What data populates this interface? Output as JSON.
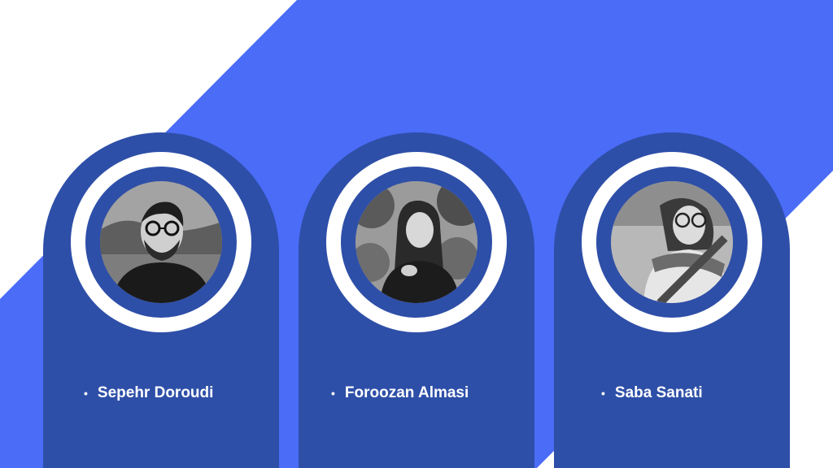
{
  "colors": {
    "accent": "#4a6cf7",
    "card": "#2e4fa8",
    "ring": "#ffffff"
  },
  "team": [
    {
      "name": "Sepehr Doroudi"
    },
    {
      "name": "Foroozan Almasi"
    },
    {
      "name": "Saba Sanati"
    }
  ]
}
